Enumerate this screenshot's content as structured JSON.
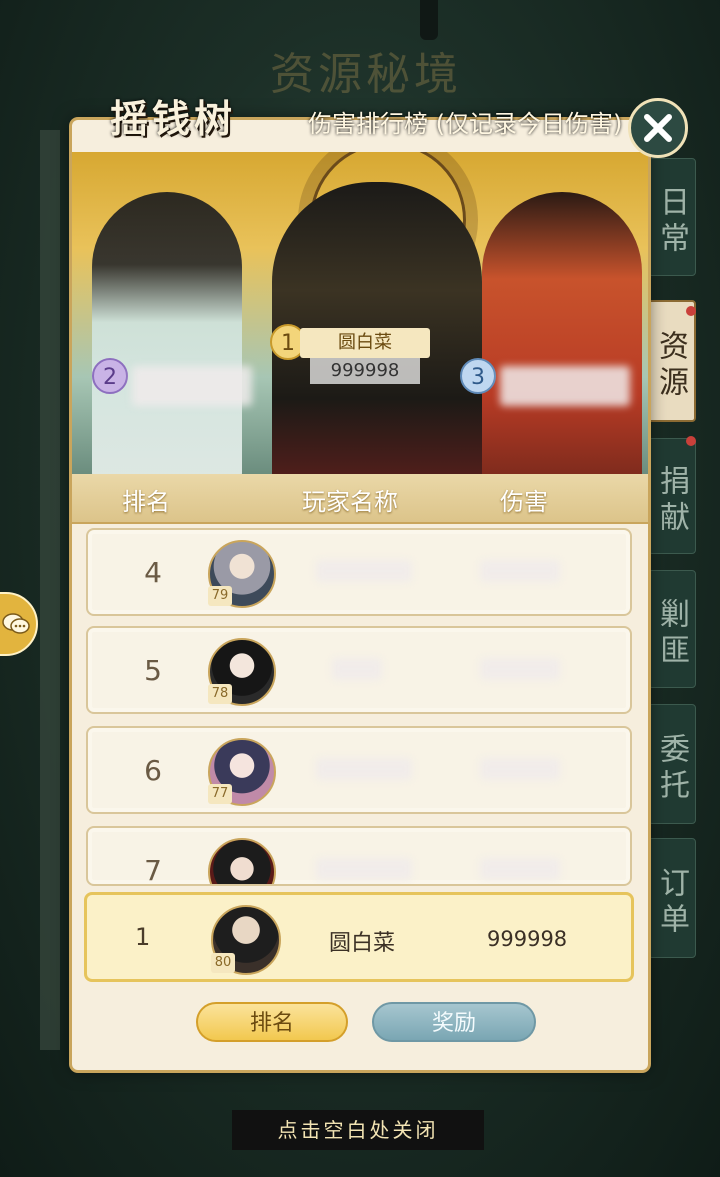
{
  "background": {
    "title": "资源秘境"
  },
  "header": {
    "calligraphy_title": "摇钱树",
    "subtitle": "伤害排行榜 (仅记录今日伤害)"
  },
  "tabs": [
    {
      "label": "日常",
      "active": false,
      "dot": false
    },
    {
      "label": "资源",
      "active": true,
      "dot": true
    },
    {
      "label": "捐献",
      "active": false,
      "dot": true
    },
    {
      "label": "剿匪",
      "active": false,
      "dot": false
    },
    {
      "label": "委托",
      "active": false,
      "dot": false
    },
    {
      "label": "订单",
      "active": false,
      "dot": false
    }
  ],
  "podium": {
    "first": {
      "rank": "1",
      "name": "圆白菜",
      "score": "999998"
    },
    "second": {
      "rank": "2"
    },
    "third": {
      "rank": "3"
    }
  },
  "table": {
    "headers": [
      "排名",
      "玩家名称",
      "伤害"
    ],
    "rows": [
      {
        "rank": "4",
        "level": "79"
      },
      {
        "rank": "5",
        "level": "78"
      },
      {
        "rank": "6",
        "level": "77"
      },
      {
        "rank": "7",
        "level": ""
      }
    ]
  },
  "self": {
    "rank": "1",
    "level": "80",
    "name": "圆白菜",
    "score": "999998"
  },
  "buttons": {
    "rank": "排名",
    "reward": "奖励"
  },
  "footer": {
    "hint": "点击空白处关闭"
  },
  "colors": {
    "accent_gold": "#f2c84f",
    "panel": "#f6eedd",
    "tab_bg": "#203a32",
    "badge_red": "#c9403a"
  }
}
